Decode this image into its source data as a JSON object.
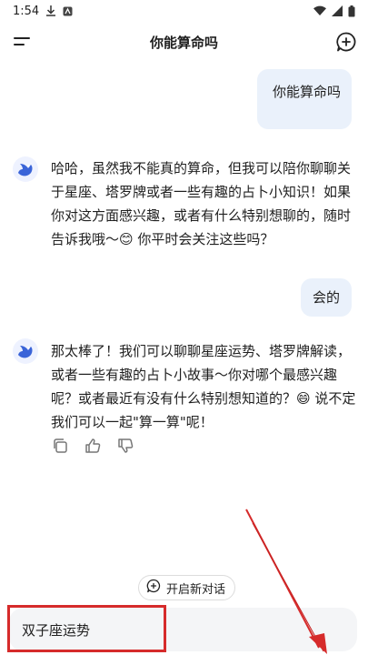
{
  "status_bar": {
    "time": "1:54"
  },
  "header": {
    "title": "你能算命吗"
  },
  "messages": [
    {
      "role": "user",
      "text": "你能算命吗"
    },
    {
      "role": "ai",
      "text": "哈哈，虽然我不能真的算命，但我可以陪你聊聊关于星座、塔罗牌或者一些有趣的占卜小知识！如果你对这方面感兴趣，或者有什么特别想聊的，随时告诉我哦～😊 你平时会关注这些吗？"
    },
    {
      "role": "user",
      "text": "会的"
    },
    {
      "role": "ai",
      "text": "那太棒了！我们可以聊聊星座运势、塔罗牌解读，或者一些有趣的占卜小故事～你对哪个最感兴趣呢？或者最近有没有什么特别想知道的？😄 说不定我们可以一起\"算一算\"呢！"
    }
  ],
  "new_topic": {
    "label": "开启新对话"
  },
  "input": {
    "value": "双子座运势"
  },
  "colors": {
    "highlight": "#d62b2b",
    "user_bubble": "#eaf1fb",
    "input_bg": "#f4f5f7"
  }
}
